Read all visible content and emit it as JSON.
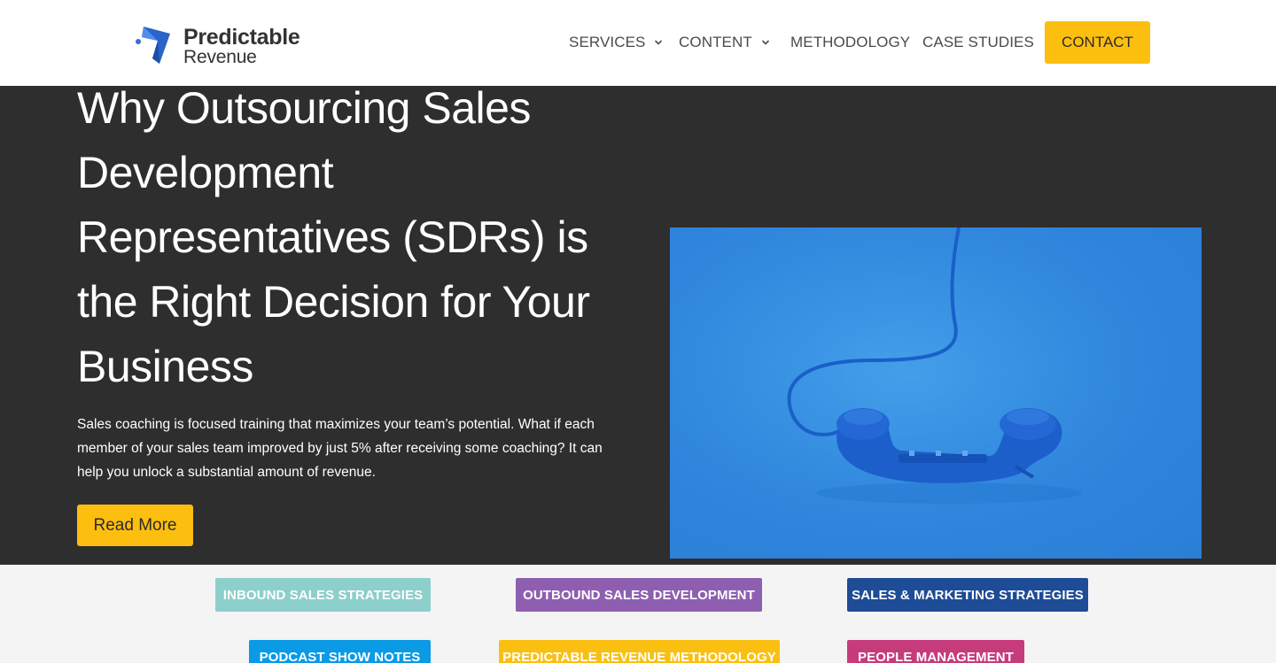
{
  "header": {
    "logo": {
      "line1": "Predictable",
      "line2": "Revenue"
    },
    "nav": [
      {
        "label": "SERVICES",
        "has_dropdown": true
      },
      {
        "label": "CONTENT",
        "has_dropdown": true
      },
      {
        "label": "METHODOLOGY",
        "has_dropdown": false
      },
      {
        "label": "CASE STUDIES",
        "has_dropdown": false
      }
    ],
    "contact_label": "CONTACT"
  },
  "hero": {
    "title": "Why Outsourcing Sales Development Representatives (SDRs) is the Right Decision for Your Business",
    "description": "Sales coaching is focused training that maximizes your team’s potential. What if each member of your sales team improved by just 5% after receiving some coaching? It can help you unlock a substantial amount of revenue.",
    "read_more_label": "Read More",
    "image_subject": "telephone-handset-icon"
  },
  "categories": [
    {
      "label": "INBOUND SALES STRATEGIES",
      "color": "#8ccfcb"
    },
    {
      "label": "OUTBOUND SALES DEVELOPMENT",
      "color": "#8e5fb0"
    },
    {
      "label": "SALES & MARKETING STRATEGIES",
      "color": "#1e4c96"
    },
    {
      "label": "PODCAST SHOW NOTES",
      "color": "#0a9ae6"
    },
    {
      "label": "PREDICTABLE REVENUE METHODOLOGY",
      "color": "#fbbf12"
    },
    {
      "label": "PEOPLE MANAGEMENT",
      "color": "#c63b7c"
    }
  ],
  "colors": {
    "accent": "#fcbf0f",
    "hero_bg": "#2e2e2e",
    "logo_blue": "#2f6fd6"
  }
}
